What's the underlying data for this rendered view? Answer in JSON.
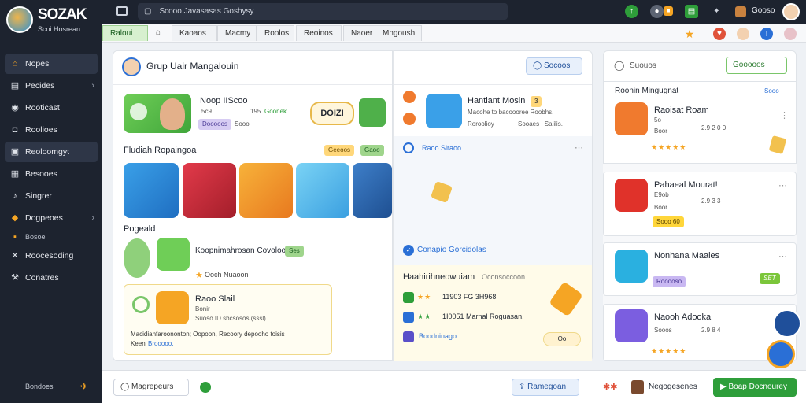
{
  "app": {
    "logo_title": "SOZAK",
    "logo_subtitle": "Scoi Hosrean"
  },
  "sidebar": {
    "items": [
      {
        "label": "Nopes",
        "icon": "home-icon"
      },
      {
        "label": "Pecides",
        "icon": "document-icon"
      },
      {
        "label": "Rooticast",
        "icon": "podcast-icon"
      },
      {
        "label": "Roolioes",
        "icon": "camera-icon"
      },
      {
        "label": "Reoloomgyt",
        "icon": "document-icon"
      },
      {
        "label": "Besooes",
        "icon": "gift-icon"
      },
      {
        "label": "Singrer",
        "icon": "music-icon"
      },
      {
        "label": "Dogpeoes",
        "icon": "tag-icon"
      },
      {
        "label": "Bosoe",
        "icon": "folder-icon"
      },
      {
        "label": "Roocesoding",
        "icon": "tools-icon"
      },
      {
        "label": "Conatres",
        "icon": "wrench-icon"
      }
    ],
    "footer": "Bondoes"
  },
  "topbar": {
    "search_text": "Scooo  Javasasas Goshysy",
    "user_label": "Gooso"
  },
  "tabs": [
    {
      "label": "Raloui"
    },
    {
      "label": "Kaoaos"
    },
    {
      "label": "Macmy"
    },
    {
      "label": "Roolos"
    },
    {
      "label": "Reoinos"
    },
    {
      "label": "Naoer"
    },
    {
      "label": "Mngoush"
    }
  ],
  "left_panel": {
    "title": "Grup Uair Mangalouin",
    "search_button": "Socoos",
    "featured": {
      "title": "Noop IIScoo",
      "meta1": "5c9",
      "meta2": "195",
      "badge": "Goonek",
      "pill": "Dooooos",
      "meta3": "Sooo",
      "bubble": "DOIZI"
    },
    "section1": {
      "title": "Fludiah Ropaingoa",
      "tag1": "Geeoos",
      "tag2": "Gaoo"
    },
    "section2": {
      "title": "Pogeald",
      "item_title": "Koopnimahrosan Covoloo",
      "item_pill": "Ses",
      "item_sub": "Ooch Nuaoon"
    },
    "card": {
      "title": "Raoo Slail",
      "line1": "Bonir",
      "line2": "Suoso ID sbcsosos (sssl)",
      "desc": "Macidiahfaroononton; Oopoon, Recoory depooho toisis",
      "desc2": "Keen",
      "link": "Brooooo."
    }
  },
  "middle_panel": {
    "header": {
      "title": "Hantiant Mosin",
      "line1": "Macohe to bacoooree Roobhs.",
      "line2": "Roroolioy",
      "line3": "Sooaes I Saiilis.",
      "badge": "3"
    },
    "subheader": "Raoo Siraoo",
    "link": "Conapio Gorcidolas",
    "section": {
      "title": "Haahirihneowuiam",
      "subtitle": "Oconsoccoon",
      "rows": [
        {
          "code": "11903 FG 3H968"
        },
        {
          "code": "1I0051 Marnal Roguasan."
        },
        {
          "code": "Boodninago"
        }
      ],
      "round_badge": "Oo"
    }
  },
  "right_panel": {
    "search_label": "Suouos",
    "search_button": "Gooooos",
    "title": "Roonin Mingugnat",
    "title_right": "Sooo",
    "apps": [
      {
        "name": "Raoisat Roam",
        "meta": "2.9 2 0 0",
        "meta_prefix": "5o",
        "sub": "Boor"
      },
      {
        "name": "Pahaeal Mourat!",
        "meta": "2.9 3 3",
        "prefix": "E9ob",
        "sub": "Boor",
        "badge": "Sooo 60"
      },
      {
        "name": "Nonhana Maales",
        "prefix": "Rooooso",
        "badge": "SET"
      },
      {
        "name": "Naooh Adooka",
        "meta": "2.9 8 4",
        "prefix": "Sooos"
      }
    ]
  },
  "bottombar": {
    "left_button": "Magrepeurs",
    "mid_button": "Ramegoan",
    "user_label": "Negogesenes",
    "cta": "Boap Docnourey"
  },
  "colors": {
    "sidebar_bg": "#1d232f",
    "accent_green": "#2e9e3a",
    "accent_orange": "#f5a524",
    "accent_blue": "#2a6fd6"
  }
}
